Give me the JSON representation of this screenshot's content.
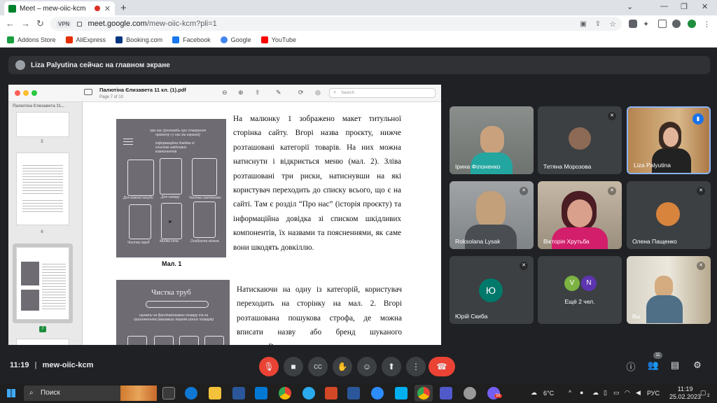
{
  "browser": {
    "tab_title": "Meet – mew-oiic-kcm",
    "tab_close": "✕",
    "new_tab": "+",
    "vpn": "VPN",
    "url_host": "meet.google.com",
    "url_path": "/mew-oiic-kcm?pli=1",
    "bookmarks": [
      {
        "label": "Addons Store",
        "color": "#1a9e3f"
      },
      {
        "label": "AliExpress",
        "color": "#e62e04"
      },
      {
        "label": "Booking.com",
        "color": "#003580"
      },
      {
        "label": "Facebook",
        "color": "#1877f2"
      },
      {
        "label": "Google",
        "color": "#4285f4"
      },
      {
        "label": "YouTube",
        "color": "#ff0000"
      }
    ]
  },
  "meet": {
    "presenter_banner": "Liza Palyutina сейчас на главном экране",
    "time": "11:19",
    "code": "mew-oiic-kcm",
    "participant_count": "11",
    "accent_red": "#ea4335"
  },
  "preview": {
    "title": "Палютіна Єлизавета 11 кл. (1).pdf",
    "page_info": "Page 7 of 10",
    "search_placeholder": "Search",
    "sidebar_title": "Палютіна Єлизавета 11...",
    "page_numbers": [
      "5",
      "6",
      "7"
    ],
    "figure_caption": "Мал. 1",
    "figure2_title": "Чистка труб",
    "fig_labels": [
      "Для кожної посуди",
      "Для паперу",
      "Чистка сантехніки",
      "Чистка труб",
      "Мийка скла",
      "Особиста гігієна"
    ],
    "fig_header": "про нас (розповідь про створення проекту і у нас ми екраної)",
    "fig_info": "інформаційна довідка зі списком шкідливих компонентів",
    "fig_text2": "шукати за брендом/назвою товару та за призначенням (вказавши перелік різних товарів)",
    "para1": "На малюнку 1 зображено макет титульної сторінка сайту. Вгорі назва проєкту, нижче розташовані категорії товарів. На них можна натиснути і відкриється меню (мал. 2). Зліва розташовані три риски, натиснувши на які користувач переходить до списку всього, що є на сайті. Там є розділ “Про нас” (історія проєкту) та інформаційна довідка зі списком шкідливих компонентів, їх назвами та поясненнями, як саме вони шкодять довкіллю.",
    "para2": "Натискаючи на одну із категорій, користувач переходить на сторінку на мал. 2. Вгорі розташована пошукова строфа, де можна вписати назву або бренд шуканого продукту.Вни-"
  },
  "participants": [
    {
      "name": "Ірина Філоненко",
      "muted": false,
      "video": true
    },
    {
      "name": "Тетяна Морозова",
      "muted": true,
      "video": false
    },
    {
      "name": "Liza Palyutina",
      "muted": false,
      "video": true,
      "speaking": true
    },
    {
      "name": "Roksolana Lysak",
      "muted": true,
      "video": true
    },
    {
      "name": "Вікторія Хрутьба",
      "muted": true,
      "video": true
    },
    {
      "name": "Олена Пащенко",
      "muted": true,
      "video": false
    },
    {
      "name": "Юрій Скиба",
      "muted": true,
      "video": false,
      "initial": "Ю"
    },
    {
      "name": "Ещё 2 чел.",
      "initials": [
        "V",
        "N"
      ]
    },
    {
      "name": "Вы",
      "muted": true,
      "video": true
    }
  ],
  "taskbar": {
    "search": "Поиск",
    "weather": "6°C",
    "lang": "РУС",
    "time": "11:19",
    "date": "25.02.2023",
    "notif_badge": "56",
    "notif_count": "2"
  }
}
